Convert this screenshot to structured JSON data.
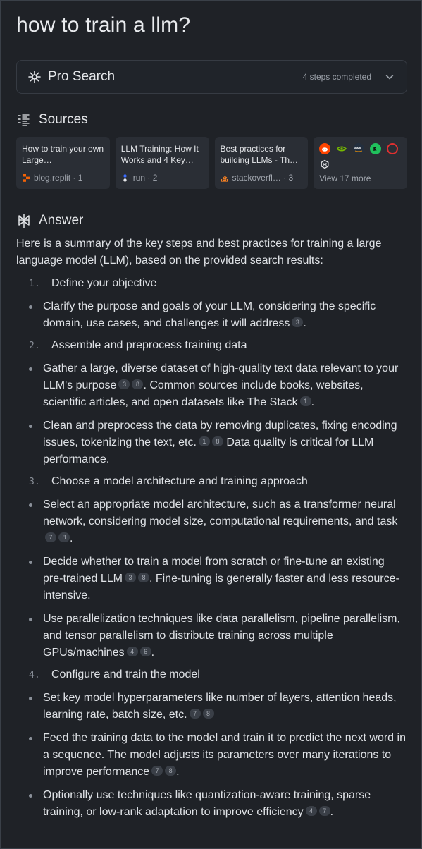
{
  "query": "how to train a llm?",
  "pro_search": {
    "label": "Pro Search",
    "steps": "4 steps completed"
  },
  "sources": {
    "heading": "Sources",
    "cards": [
      {
        "title": "How to train your own Large…",
        "site": "blog.replit",
        "index": "1",
        "fav_color": "#f26207"
      },
      {
        "title": "LLM Training: How It Works and 4 Key…",
        "site": "run",
        "index": "2",
        "fav_color": "#3b6cff"
      },
      {
        "title": "Best practices for building LLMs - Th…",
        "site": "stackoverfl…",
        "index": "3",
        "fav_color": "#f48024"
      }
    ],
    "more": {
      "label": "View 17 more",
      "icons": [
        "reddit-icon",
        "nvidia-icon",
        "aws-icon",
        "green-logo-icon",
        "red-ring-icon",
        "openai-icon"
      ]
    }
  },
  "answer": {
    "heading": "Answer",
    "intro": "Here is a summary of the key steps and best practices for training a large language model (LLM), based on the provided search results:",
    "sections": [
      {
        "num": "1.",
        "title": "Define your objective",
        "bullets": [
          {
            "text": "Clarify the purpose and goals of your LLM, considering the specific domain, use cases, and challenges it will address",
            "cites": [
              "3"
            ],
            "after": "."
          }
        ]
      },
      {
        "num": "2.",
        "title": "Assemble and preprocess training data",
        "bullets": [
          {
            "text": "Gather a large, diverse dataset of high-quality text data relevant to your LLM's purpose",
            "cites": [
              "3",
              "8"
            ],
            "after": ". Common sources include books, websites, scientific articles, and open datasets like The Stack",
            "cites2": [
              "1"
            ],
            "after2": "."
          },
          {
            "text": "Clean and preprocess the data by removing duplicates, fixing encoding issues, tokenizing the text, etc.",
            "cites": [
              "1",
              "8"
            ],
            "after": " Data quality is critical for LLM performance."
          }
        ]
      },
      {
        "num": "3.",
        "title": "Choose a model architecture and training approach",
        "bullets": [
          {
            "text": "Select an appropriate model architecture, such as a transformer neural network, considering model size, computational requirements, and task",
            "cites": [
              "7",
              "8"
            ],
            "after": "."
          },
          {
            "text": "Decide whether to train a model from scratch or fine-tune an existing pre-trained LLM",
            "cites": [
              "3",
              "8"
            ],
            "after": ". Fine-tuning is generally faster and less resource-intensive."
          },
          {
            "text": "Use parallelization techniques like data parallelism, pipeline parallelism, and tensor parallelism to distribute training across multiple GPUs/machines",
            "cites": [
              "4",
              "6"
            ],
            "after": "."
          }
        ]
      },
      {
        "num": "4.",
        "title": "Configure and train the model",
        "bullets": [
          {
            "text": "Set key model hyperparameters like number of layers, attention heads, learning rate, batch size, etc.",
            "cites": [
              "7",
              "8"
            ],
            "after": ""
          },
          {
            "text": "Feed the training data to the model and train it to predict the next word in a sequence. The model adjusts its parameters over many iterations to improve performance",
            "cites": [
              "7",
              "8"
            ],
            "after": "."
          },
          {
            "text": "Optionally use techniques like quantization-aware training, sparse training, or low-rank adaptation to improve efficiency",
            "cites": [
              "4",
              "7"
            ],
            "after": "."
          }
        ]
      }
    ]
  }
}
